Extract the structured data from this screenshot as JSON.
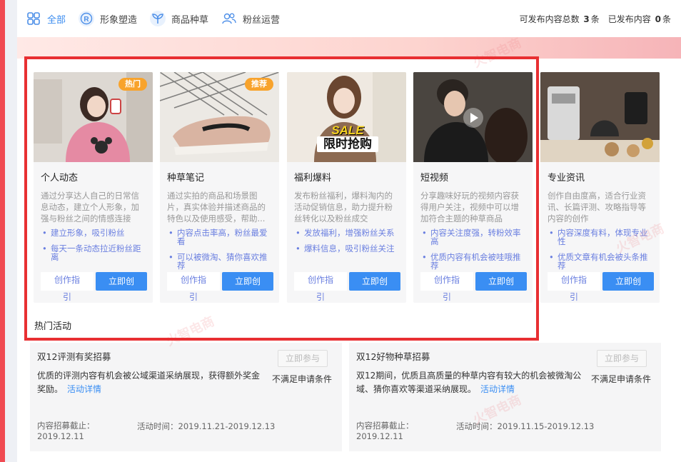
{
  "tabs": [
    {
      "label": "全部",
      "icon": "grid-icon",
      "active": true
    },
    {
      "label": "形象塑造",
      "icon": "r-badge-icon"
    },
    {
      "label": "商品种草",
      "icon": "sprout-icon"
    },
    {
      "label": "粉丝运营",
      "icon": "users-icon"
    }
  ],
  "summary": {
    "total_label": "可发布内容总数",
    "total_count": "3",
    "unit1": "条",
    "published_label": "已发布内容",
    "published_count": "0",
    "unit2": "条"
  },
  "cards": [
    {
      "title": "个人动态",
      "tag": "热门",
      "desc": "通过分享达人自己的日常信息动态，建立个人形象，加强与粉丝之间的情感连接",
      "points": [
        "建立形象，吸引粉丝",
        "每天一条动态拉近粉丝距离"
      ],
      "guide": "创作指",
      "guide2": "引",
      "create": "立即创"
    },
    {
      "title": "种草笔记",
      "tag": "推荐",
      "desc": "通过实拍的商品和场景图片，真实体验并描述商品的特色以及使用感受，帮助...",
      "points": [
        "内容点击率高，粉丝最爱看",
        "可以被微淘、猜你喜欢推荐"
      ],
      "guide": "创作指",
      "guide2": "引",
      "create": "立即创"
    },
    {
      "title": "福利爆料",
      "tag": "",
      "sale_text1": "SALE",
      "sale_text2": "限时抢购",
      "desc": "发布粉丝福利，爆料淘内的活动促销信息，助力提升粉丝转化以及粉丝成交",
      "points": [
        "发放福利，增强粉丝关系",
        "爆料信息，吸引粉丝关注"
      ],
      "guide": "创作指",
      "guide2": "引",
      "create": "立即创"
    },
    {
      "title": "短视频",
      "tag": "",
      "desc": "分享趣味好玩的视频内容获得用户关注，视频中可以增加符合主题的种草商品",
      "points": [
        "内容关注度强，转粉效率高",
        "优质内容有机会被哇哦推荐"
      ],
      "guide": "创作指",
      "guide2": "引",
      "create": "立即创"
    },
    {
      "title": "专业资讯",
      "tag": "",
      "desc": "创作自由度高，适合行业资讯、长篇评测、攻略指导等内容的创作",
      "points": [
        "内容深度有料，体现专业性",
        "优质文章有机会被头条推荐"
      ],
      "guide": "创作指",
      "guide2": "引",
      "create": "立即创"
    }
  ],
  "hot_section_title": "热门活动",
  "activities": [
    {
      "title": "双12评测有奖招募",
      "button": "立即参与",
      "desc": "优质的评测内容有机会被公域渠道采纳展现，获得额外奖金奖励。",
      "link": "活动详情",
      "note": "不满足申请条件",
      "deadline_label": "内容招募截止：",
      "deadline_date": "2019.12.11",
      "time": "活动时间：2019.11.21-2019.12.13"
    },
    {
      "title": "双12好物种草招募",
      "button": "立即参与",
      "desc": "双12期间，优质且高质量的种草内容有较大的机会被微淘公域、猜你喜欢等渠道采纳展现。",
      "link": "活动详情",
      "note": "不满足申请条件",
      "deadline_label": "内容招募截止：",
      "deadline_date": "2019.12.11",
      "time": "活动时间：2019.11.15-2019.12.13"
    }
  ],
  "watermark": "火智电商",
  "colors": {
    "accent": "#3a8ef3",
    "tag": "#f8a32c",
    "frame": "#e82f32",
    "bullet": "#6a7fe0"
  }
}
